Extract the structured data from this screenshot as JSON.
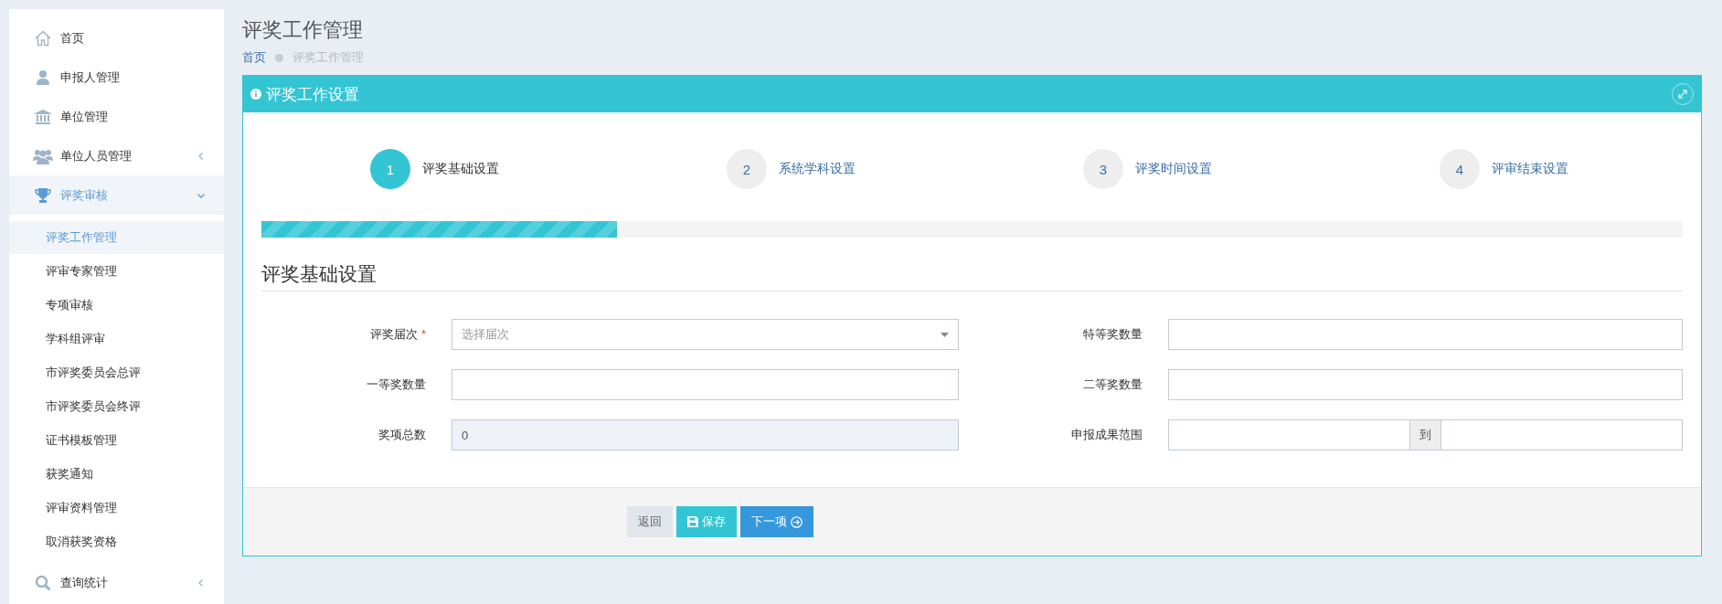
{
  "sidebar": {
    "items": [
      {
        "label": "首页",
        "selected": false
      },
      {
        "label": "申报人管理",
        "selected": false
      },
      {
        "label": "单位管理",
        "selected": false
      },
      {
        "label": "单位人员管理",
        "selected": false,
        "expanded": false
      },
      {
        "label": "评奖审核",
        "selected": true,
        "expanded": true,
        "children": [
          {
            "label": "评奖工作管理",
            "selected": true
          },
          {
            "label": "评审专家管理",
            "selected": false
          },
          {
            "label": "专项审核",
            "selected": false
          },
          {
            "label": "学科组评审",
            "selected": false
          },
          {
            "label": "市评奖委员会总评",
            "selected": false
          },
          {
            "label": "市评奖委员会终评",
            "selected": false
          },
          {
            "label": "证书模板管理",
            "selected": false
          },
          {
            "label": "获奖通知",
            "selected": false
          },
          {
            "label": "评审资料管理",
            "selected": false
          },
          {
            "label": "取消获奖资格",
            "selected": false
          }
        ]
      },
      {
        "label": "查询统计",
        "selected": false,
        "expanded": false
      }
    ]
  },
  "page": {
    "title": "评奖工作管理",
    "breadcrumb": [
      {
        "label": "首页",
        "kind": "link"
      },
      {
        "label": "评奖工作管理",
        "kind": "current"
      }
    ]
  },
  "panel": {
    "title": "评奖工作设置",
    "steps": [
      {
        "number": "1",
        "label": "评奖基础设置",
        "selected": true
      },
      {
        "number": "2",
        "label": "系统学科设置",
        "selected": false
      },
      {
        "number": "3",
        "label": "评奖时间设置",
        "selected": false
      },
      {
        "number": "4",
        "label": "评审结束设置",
        "selected": false
      }
    ],
    "progress": {
      "level": 0.25
    },
    "section_title": "评奖基础设置",
    "fields": [
      {
        "kind": "select",
        "label": "评奖届次",
        "required_mark": "*",
        "placeholder": "选择届次"
      },
      {
        "kind": "text",
        "label": "特等奖数量"
      },
      {
        "kind": "text",
        "label": "一等奖数量"
      },
      {
        "kind": "text",
        "label": "二等奖数量"
      },
      {
        "kind": "readonly",
        "label": "奖项总数",
        "value": "0"
      },
      {
        "kind": "range",
        "label": "申报成果范围",
        "separator": "到"
      }
    ],
    "buttons": [
      {
        "kind": "back",
        "label": "返回"
      },
      {
        "kind": "save",
        "label": "保存"
      },
      {
        "kind": "next",
        "label": "下一项"
      }
    ]
  }
}
